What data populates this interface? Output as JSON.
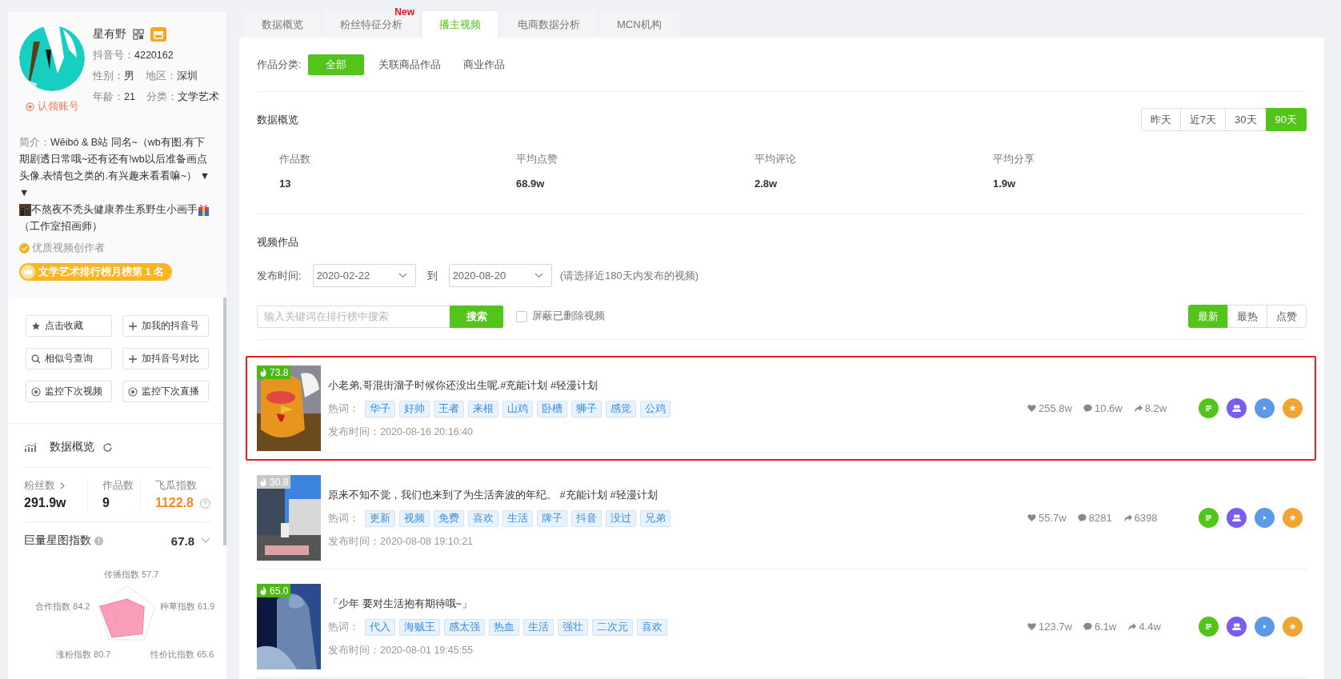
{
  "profile": {
    "name": "星有野",
    "douyin_id_label": "抖音号：",
    "douyin_id": "4220162",
    "gender_label": "性别：",
    "gender": "男",
    "region_label": "地区：",
    "region": "深圳",
    "age_label": "年龄：",
    "age": "21",
    "category_label": "分类：",
    "category": "文学艺术",
    "claim": "认领账号",
    "bio_label": "简介：",
    "bio_parts": [
      "Wēibó & B站 同名~（wb有图.有下期剧透日常哦~还有还有!wb以后准备画点头像.表情包之类的.有兴趣来看看嘛~） ▼ ▼",
      "不熬夜不秃头健康养生系野生小画手",
      "（工作室招画师）"
    ],
    "badge": "优质视频创作者",
    "rank": "文学艺术排行榜月榜第 1 名"
  },
  "actions": [
    {
      "label": "点击收藏",
      "kind": "star"
    },
    {
      "label": "加我的抖音号",
      "kind": "plus"
    },
    {
      "label": "相似号查询",
      "kind": "search"
    },
    {
      "label": "加抖音号对比",
      "kind": "plus"
    },
    {
      "label": "监控下次视频",
      "kind": "eye"
    },
    {
      "label": "监控下次直播",
      "kind": "eye"
    }
  ],
  "overview": {
    "title": "数据概览",
    "fans_label": "粉丝数",
    "fans": "291.9w",
    "works_label": "作品数",
    "works": "9",
    "feigua_label": "飞瓜指数",
    "feigua": "1122.8",
    "star_label": "巨量星图指数",
    "star_value": "67.8",
    "radar_labels": [
      "传播指数 57.7",
      "合作指数 84.2",
      "种草指数 61.9",
      "涨粉指数 80.7",
      "性价比指数 65.6"
    ]
  },
  "tabs": [
    {
      "label": "数据概览",
      "selected": false
    },
    {
      "label": "粉丝特征分析",
      "selected": false,
      "badge": "New"
    },
    {
      "label": "播主视频",
      "selected": true
    },
    {
      "label": "电商数据分析",
      "selected": false
    },
    {
      "label": "MCN机构",
      "selected": false
    }
  ],
  "category_filter": {
    "label": "作品分类:",
    "options": [
      {
        "label": "全部",
        "selected": true
      },
      {
        "label": "关联商品作品",
        "selected": false
      },
      {
        "label": "商业作品",
        "selected": false
      }
    ]
  },
  "summary": {
    "title": "数据概览",
    "ranges": [
      {
        "label": "昨天",
        "selected": false
      },
      {
        "label": "近7天",
        "selected": false
      },
      {
        "label": "30天",
        "selected": false
      },
      {
        "label": "90天",
        "selected": true
      }
    ],
    "stats": [
      {
        "label": "作品数",
        "value": "13"
      },
      {
        "label": "平均点赞",
        "value": "68.9w"
      },
      {
        "label": "平均评论",
        "value": "2.8w"
      },
      {
        "label": "平均分享",
        "value": "1.9w"
      }
    ]
  },
  "videos_section": {
    "title": "视频作品",
    "date_label": "发布时间:",
    "start": "2020-02-22",
    "to": "到",
    "end": "2020-08-20",
    "hint": "(请选择近180天内发布的视频)",
    "search_placeholder": "输入关键词在排行榜中搜索",
    "search_button": "搜索",
    "hide_deleted": {
      "label": "屏蔽已删除视频",
      "checked": false
    },
    "sorts": [
      {
        "label": "最新",
        "selected": true
      },
      {
        "label": "最热",
        "selected": false
      },
      {
        "label": "点赞",
        "selected": false
      }
    ]
  },
  "videos": [
    {
      "score": "73.8",
      "hot": true,
      "selected": true,
      "title": "小老弟,哥混街溜子时候你还没出生呢.#充能计划 #轻漫计划",
      "hotwords_label": "热词：",
      "hotwords": [
        "华子",
        "好帅",
        "王者",
        "来根",
        "山鸡",
        "卧槽",
        "狮子",
        "感觉",
        "公鸡"
      ],
      "published": "发布时间：2020-08-16 20:16:40",
      "likes": "255.8w",
      "comments": "10.6w",
      "shares": "8.2w"
    },
    {
      "score": "30.8",
      "hot": false,
      "selected": false,
      "title": "原来不知不觉，我们也来到了为生活奔波的年纪。 #充能计划 #轻漫计划",
      "hotwords_label": "热词：",
      "hotwords": [
        "更新",
        "视频",
        "免费",
        "喜欢",
        "生活",
        "牌子",
        "抖音",
        "没过",
        "兄弟"
      ],
      "published": "发布时间：2020-08-08 19:10:21",
      "likes": "55.7w",
      "comments": "8281",
      "shares": "6398"
    },
    {
      "score": "65.0",
      "hot": true,
      "selected": false,
      "title": "「少年 要对生活抱有期待哦~」",
      "hotwords_label": "热词：",
      "hotwords": [
        "代入",
        "海贼王",
        "感太强",
        "热血",
        "生活",
        "强壮",
        "二次元",
        "喜欢"
      ],
      "published": "发布时间：2020-08-01 19:45:55",
      "likes": "123.7w",
      "comments": "6.1w",
      "shares": "4.4w"
    }
  ]
}
